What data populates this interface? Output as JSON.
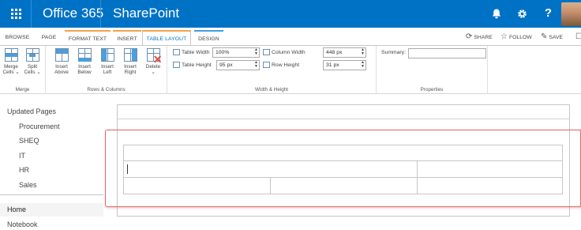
{
  "suite_bar": {
    "app_launcher_icon": "waffle-icon",
    "product": "Office 365",
    "app": "SharePoint",
    "notifications_icon": "bell-icon",
    "settings_icon": "gear-icon",
    "help_label": "?",
    "colors": {
      "background": "#0072c6"
    }
  },
  "ribbon_tabs": [
    {
      "label": "BROWSE"
    },
    {
      "label": "PAGE"
    },
    {
      "label": "FORMAT TEXT"
    },
    {
      "label": "INSERT"
    },
    {
      "label": "TABLE LAYOUT",
      "active": true
    },
    {
      "label": "DESIGN"
    }
  ],
  "ribbon_actions": {
    "share": "SHARE",
    "follow": "FOLLOW",
    "save": "SAVE"
  },
  "ribbon": {
    "merge": {
      "merge_cells": [
        "Merge",
        "Cells ⌄"
      ],
      "split_cells": [
        "Split",
        "Cells ⌄"
      ],
      "label": "Merge"
    },
    "rows_columns": {
      "insert_above": [
        "Insert",
        "Above"
      ],
      "insert_below": [
        "Insert",
        "Below"
      ],
      "insert_left": [
        "Insert",
        "Left"
      ],
      "insert_right": [
        "Insert",
        "Right"
      ],
      "delete": [
        "Delete",
        "⌄"
      ],
      "label": "Rows & Columns"
    },
    "width_height": {
      "table_width_label": "Table Width",
      "table_width_value": "100%",
      "table_height_label": "Table Height",
      "table_height_value": "95 px",
      "column_width_label": "Column Width",
      "column_width_value": "448 px",
      "row_height_label": "Row Height",
      "row_height_value": "31 px",
      "label": "Width & Height"
    },
    "properties": {
      "summary_label": "Summary:",
      "summary_value": "",
      "label": "Properties"
    }
  },
  "left_nav": {
    "heading": "Updated Pages",
    "items": [
      "Procurement",
      "SHEQ",
      "IT",
      "HR",
      "Sales"
    ],
    "home": "Home",
    "notebook": "Notebook"
  }
}
